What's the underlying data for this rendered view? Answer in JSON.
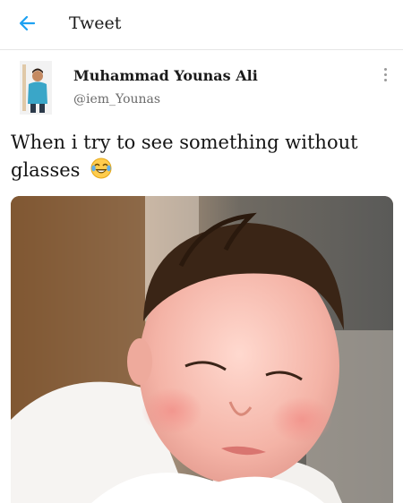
{
  "header": {
    "title": "Tweet",
    "back_icon": "arrow-left-icon",
    "accent": "#1da1f2"
  },
  "author": {
    "name": "Muhammad Younas Ali",
    "handle": "@iem_Younas"
  },
  "tweet": {
    "text": "When i try to see something without glasses",
    "emoji_icon": "face-with-tears-of-joy-icon"
  },
  "media": {
    "icon": "photo-baby-squinting"
  }
}
